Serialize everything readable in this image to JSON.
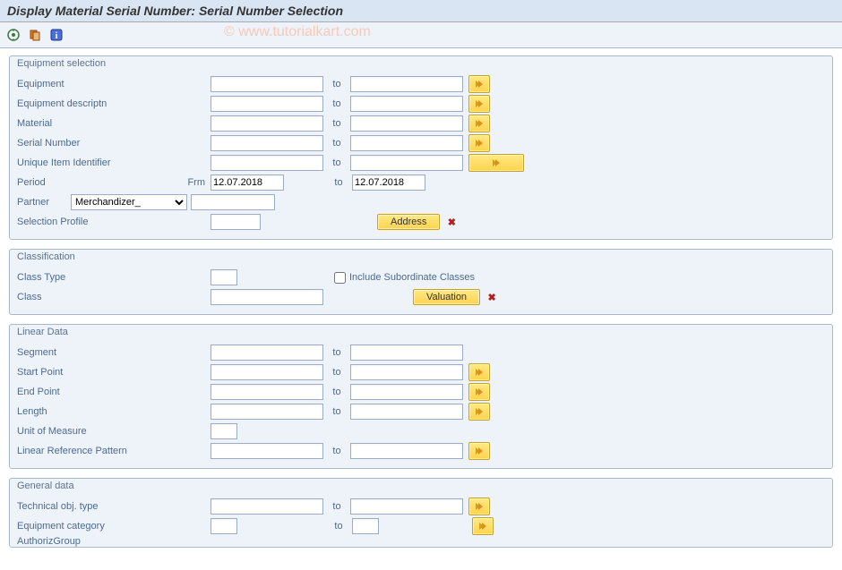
{
  "title": "Display Material Serial Number: Serial Number Selection",
  "watermark": "© www.tutorialkart.com",
  "labels": {
    "to": "to"
  },
  "groups": {
    "equipment": {
      "title": "Equipment selection",
      "rows": {
        "equipment": "Equipment",
        "equip_desc": "Equipment descriptn",
        "material": "Material",
        "serial": "Serial Number",
        "uii": "Unique Item Identifier",
        "period": "Period",
        "period_frm": "Frm",
        "partner": "Partner",
        "sel_profile": "Selection Profile"
      },
      "values": {
        "equipment_from": "",
        "equipment_to": "",
        "equip_desc_from": "",
        "equip_desc_to": "",
        "material_from": "",
        "material_to": "",
        "serial_from": "",
        "serial_to": "",
        "uii_from": "",
        "uii_to": "",
        "period_from": "12.07.2018",
        "period_to": "12.07.2018",
        "partner_select": "Merchandizer_",
        "partner_val": "",
        "sel_profile_val": ""
      },
      "buttons": {
        "address": "Address"
      }
    },
    "classification": {
      "title": "Classification",
      "rows": {
        "class_type": "Class Type",
        "class": "Class",
        "incl_sub": "Include Subordinate Classes"
      },
      "values": {
        "class_type": "",
        "class": "",
        "incl_sub": false
      },
      "buttons": {
        "valuation": "Valuation"
      }
    },
    "linear": {
      "title": "Linear Data",
      "rows": {
        "segment": "Segment",
        "start": "Start Point",
        "end": "End Point",
        "length": "Length",
        "uom": "Unit of Measure",
        "lrp": "Linear Reference Pattern"
      },
      "values": {
        "segment_from": "",
        "segment_to": "",
        "start_from": "",
        "start_to": "",
        "end_from": "",
        "end_to": "",
        "length_from": "",
        "length_to": "",
        "uom": "",
        "lrp_from": "",
        "lrp_to": ""
      }
    },
    "general": {
      "title": "General data",
      "rows": {
        "tech_obj": "Technical obj. type",
        "equip_cat": "Equipment category",
        "authgrp": "AuthorizGroup"
      },
      "values": {
        "tech_obj_from": "",
        "tech_obj_to": "",
        "equip_cat_from": "",
        "equip_cat_to": "",
        "authgrp_from": "",
        "authgrp_to": ""
      }
    }
  }
}
